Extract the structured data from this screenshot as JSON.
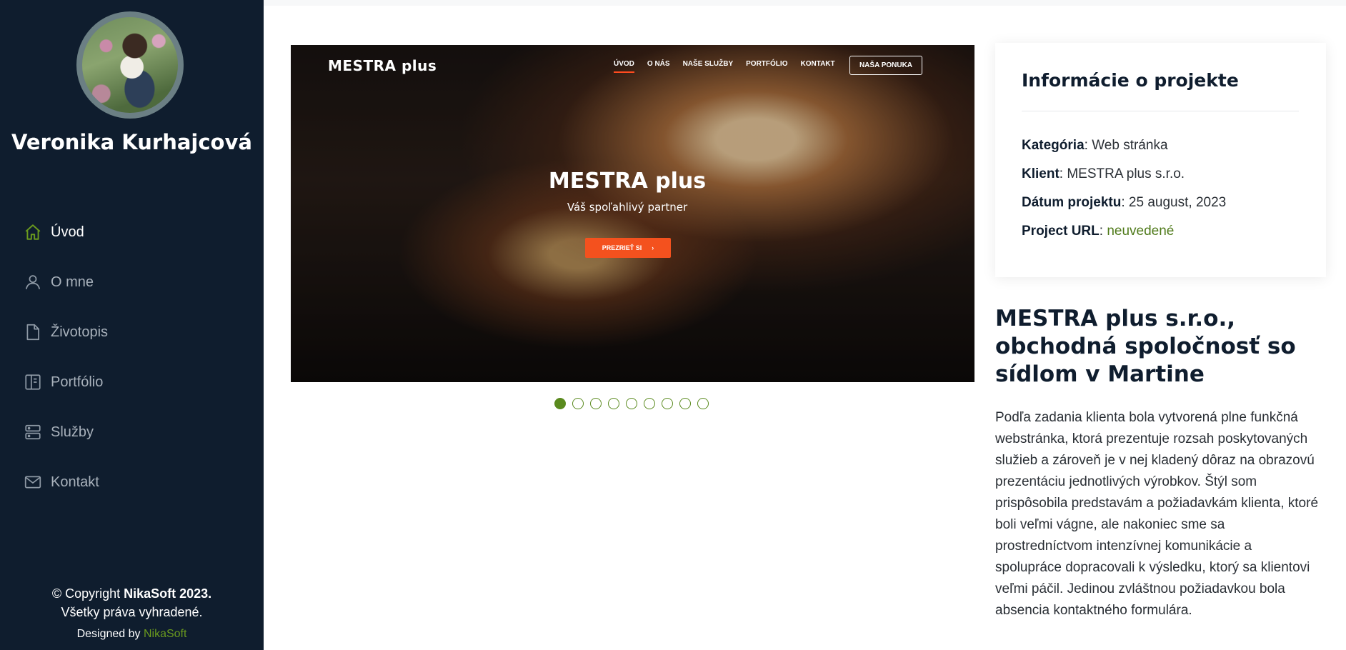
{
  "sidebar": {
    "name": "Veronika Kurhajcová",
    "nav": [
      {
        "label": "Úvod",
        "icon": "home-icon",
        "active": true
      },
      {
        "label": "O mne",
        "icon": "person-icon"
      },
      {
        "label": "Životopis",
        "icon": "file-icon"
      },
      {
        "label": "Portfólio",
        "icon": "portfolio-icon"
      },
      {
        "label": "Služby",
        "icon": "server-icon"
      },
      {
        "label": "Kontakt",
        "icon": "mail-icon"
      }
    ],
    "footer": {
      "copyright_prefix": "© Copyright ",
      "copyright_brand": "NikaSoft 2023.",
      "rights": "Všetky práva vyhradené.",
      "designed_prefix": "Designed by ",
      "designed_link": "NikaSoft"
    }
  },
  "slider": {
    "brand": "MESTRA plus",
    "nav": [
      "ÚVOD",
      "O NÁS",
      "NAŠE SLUŽBY",
      "PORTFÓLIO",
      "KONTAKT"
    ],
    "offer_button": "NAŠA PONUKA",
    "title": "MESTRA plus",
    "subtitle": "Váš spoľahlivý partner",
    "cta": "PREZRIEŤ SI",
    "cta_arrow": "›",
    "slide_count": 9,
    "active_slide": 1
  },
  "info": {
    "title": "Informácie o projekte",
    "rows": [
      {
        "key": "Kategória",
        "value": "Web stránka"
      },
      {
        "key": "Klient",
        "value": "MESTRA plus s.r.o."
      },
      {
        "key": "Dátum projektu",
        "value": "25 august, 2023"
      },
      {
        "key": "Project URL",
        "value": "neuvedené"
      }
    ]
  },
  "description": {
    "title": "MESTRA plus s.r.o., obchodná spoločnosť so sídlom v Martine",
    "text": "Podľa zadania klienta bola vytvorená plne funkčná webstránka, ktorá prezentuje rozsah poskytovaných služieb a zároveň je v nej kladený dôraz na obrazovú prezentáciu jednotlivých výrobkov. Štýl som prispôsobila predstavám a požiadavkám klienta, ktoré boli veľmi vágne, ale nakoniec sme sa prostredníctvom intenzívnej komunikácie a spolupráce dopracovali k výsledku, ktorý sa klientovi veľmi páčil. Jedinou zvláštnou požiadavkou bola absencia kontaktného formulára."
  },
  "colors": {
    "sidebar_bg": "#0f1d2e",
    "accent_green": "#5a8a1e",
    "slider_cta": "#f4511e"
  }
}
